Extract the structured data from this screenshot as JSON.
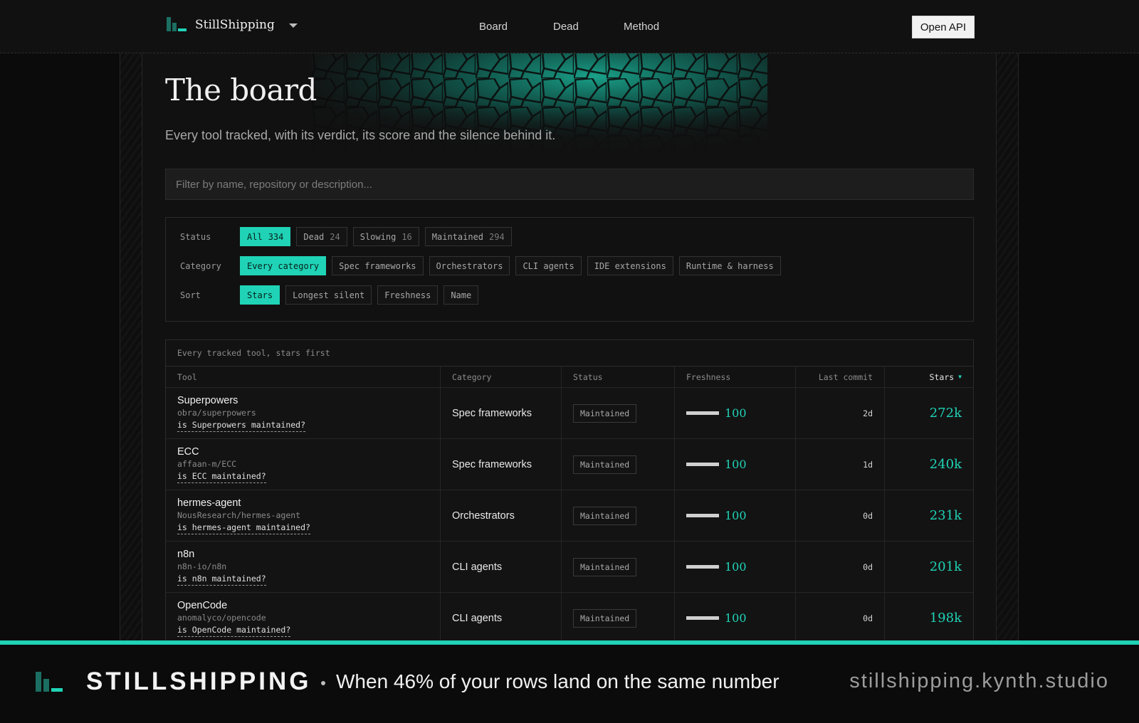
{
  "colors": {
    "accent": "#20d3b6",
    "background": "#0b0b0b",
    "panel": "#111111"
  },
  "header": {
    "brand": "StillShipping",
    "nav": [
      "Board",
      "Dead",
      "Method"
    ],
    "open_api": "Open API"
  },
  "hero": {
    "title": "The board",
    "subtitle": "Every tool tracked, with its verdict, its score and the silence behind it."
  },
  "search": {
    "placeholder": "Filter by name, repository or description..."
  },
  "filters": {
    "status": {
      "label": "Status",
      "options": [
        {
          "label": "All",
          "count": "334",
          "active": true
        },
        {
          "label": "Dead",
          "count": "24",
          "active": false
        },
        {
          "label": "Slowing",
          "count": "16",
          "active": false
        },
        {
          "label": "Maintained",
          "count": "294",
          "active": false
        }
      ]
    },
    "category": {
      "label": "Category",
      "options": [
        {
          "label": "Every category",
          "active": true
        },
        {
          "label": "Spec frameworks",
          "active": false
        },
        {
          "label": "Orchestrators",
          "active": false
        },
        {
          "label": "CLI agents",
          "active": false
        },
        {
          "label": "IDE extensions",
          "active": false
        },
        {
          "label": "Runtime & harness",
          "active": false
        }
      ]
    },
    "sort": {
      "label": "Sort",
      "options": [
        {
          "label": "Stars",
          "active": true
        },
        {
          "label": "Longest silent",
          "active": false
        },
        {
          "label": "Freshness",
          "active": false
        },
        {
          "label": "Name",
          "active": false
        }
      ]
    }
  },
  "table": {
    "caption": "Every tracked tool, stars first",
    "columns": [
      "Tool",
      "Category",
      "Status",
      "Freshness",
      "Last commit",
      "Stars"
    ],
    "rows": [
      {
        "name": "Superpowers",
        "repo": "obra/superpowers",
        "question": "is Superpowers maintained?",
        "category": "Spec frameworks",
        "status": "Maintained",
        "freshness": 100,
        "last_commit": "2d",
        "stars": "272k"
      },
      {
        "name": "ECC",
        "repo": "affaan-m/ECC",
        "question": "is ECC maintained?",
        "category": "Spec frameworks",
        "status": "Maintained",
        "freshness": 100,
        "last_commit": "1d",
        "stars": "240k"
      },
      {
        "name": "hermes-agent",
        "repo": "NousResearch/hermes-agent",
        "question": "is hermes-agent maintained?",
        "category": "Orchestrators",
        "status": "Maintained",
        "freshness": 100,
        "last_commit": "0d",
        "stars": "231k"
      },
      {
        "name": "n8n",
        "repo": "n8n-io/n8n",
        "question": "is n8n maintained?",
        "category": "CLI agents",
        "status": "Maintained",
        "freshness": 100,
        "last_commit": "0d",
        "stars": "201k"
      },
      {
        "name": "OpenCode",
        "repo": "anomalyco/opencode",
        "question": "is OpenCode maintained?",
        "category": "CLI agents",
        "status": "Maintained",
        "freshness": 100,
        "last_commit": "0d",
        "stars": "198k"
      }
    ]
  },
  "banner": {
    "brand": "STILLSHIPPING",
    "tagline": "When 46% of your rows land on the same number",
    "url": "stillshipping.kynth.studio"
  }
}
